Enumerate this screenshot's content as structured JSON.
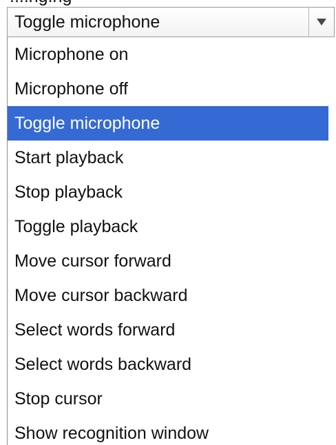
{
  "above_text": "....ng.ng",
  "select": {
    "value": "Toggle microphone",
    "options": [
      "Microphone on",
      "Microphone off",
      "Toggle microphone",
      "Start playback",
      "Stop playback",
      "Toggle playback",
      "Move cursor forward",
      "Move cursor backward",
      "Select words forward",
      "Select words backward",
      "Stop cursor",
      "Show recognition window"
    ],
    "selected_index": 2
  },
  "colors": {
    "highlight": "#3569d4",
    "text": "#111111",
    "highlight_text": "#ffffff"
  }
}
